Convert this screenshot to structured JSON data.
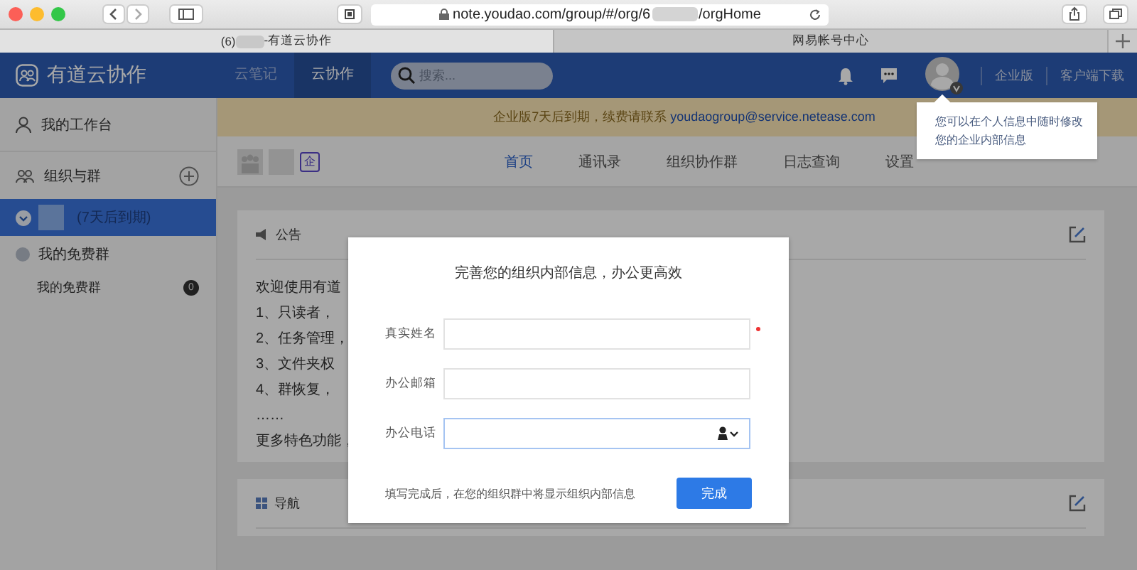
{
  "browser": {
    "url_start": "note.youdao.com/group/#/org/6",
    "url_end": "/orgHome",
    "tabs": [
      {
        "label_start": "(6)",
        "label_end": "-有道云协作",
        "selected": true
      },
      {
        "label": "网易帐号中心",
        "selected": false
      }
    ]
  },
  "app": {
    "title": "有道云协作",
    "nav": [
      {
        "label": "云笔记",
        "selected": false
      },
      {
        "label": "云协作",
        "selected": true
      }
    ],
    "search": {
      "placeholder": "搜索..."
    },
    "links": [
      "企业版",
      "客户端下载"
    ]
  },
  "sidebar": {
    "workspace": "我的工作台",
    "orgs_heading": "组织与群",
    "org": {
      "expiry": "(7天后到期)",
      "selected": true
    },
    "free_group": {
      "label": "我的免费群",
      "items": [
        {
          "label": "我的免费群",
          "count": "0"
        }
      ]
    }
  },
  "notice": {
    "text": "企业版7天后到期，续费请联系 ",
    "email": "youdaogroup@service.netease.com"
  },
  "org": {
    "badge": "企",
    "tabs": [
      {
        "label": "首页",
        "selected": true
      },
      {
        "label": "通讯录",
        "selected": false
      },
      {
        "label": "组织协作群",
        "selected": false
      },
      {
        "label": "日志查询",
        "selected": false
      },
      {
        "label": "设置",
        "selected": false
      }
    ]
  },
  "announcement": {
    "title": "公告",
    "lines": [
      "欢迎使用有道",
      "1、只读者，",
      "2、任务管理，",
      "3、文件夹权",
      "4、群恢复，",
      "……",
      "更多特色功能，"
    ]
  },
  "navigation": {
    "title": "导航"
  },
  "tooltip": {
    "lines": [
      "您可以在个人信息中随时修改",
      "您的企业内部信息"
    ]
  },
  "dialog": {
    "title": "完善您的组织内部信息，办公更高效",
    "fields": [
      {
        "label": "真实姓名",
        "required": true,
        "focused": false,
        "contact_picker": false
      },
      {
        "label": "办公邮箱",
        "required": false,
        "focused": false,
        "contact_picker": false
      },
      {
        "label": "办公电话",
        "required": false,
        "focused": true,
        "contact_picker": true
      }
    ],
    "note": "填写完成后，在您的组织群中将显示组织内部信息",
    "submit": "完成"
  }
}
